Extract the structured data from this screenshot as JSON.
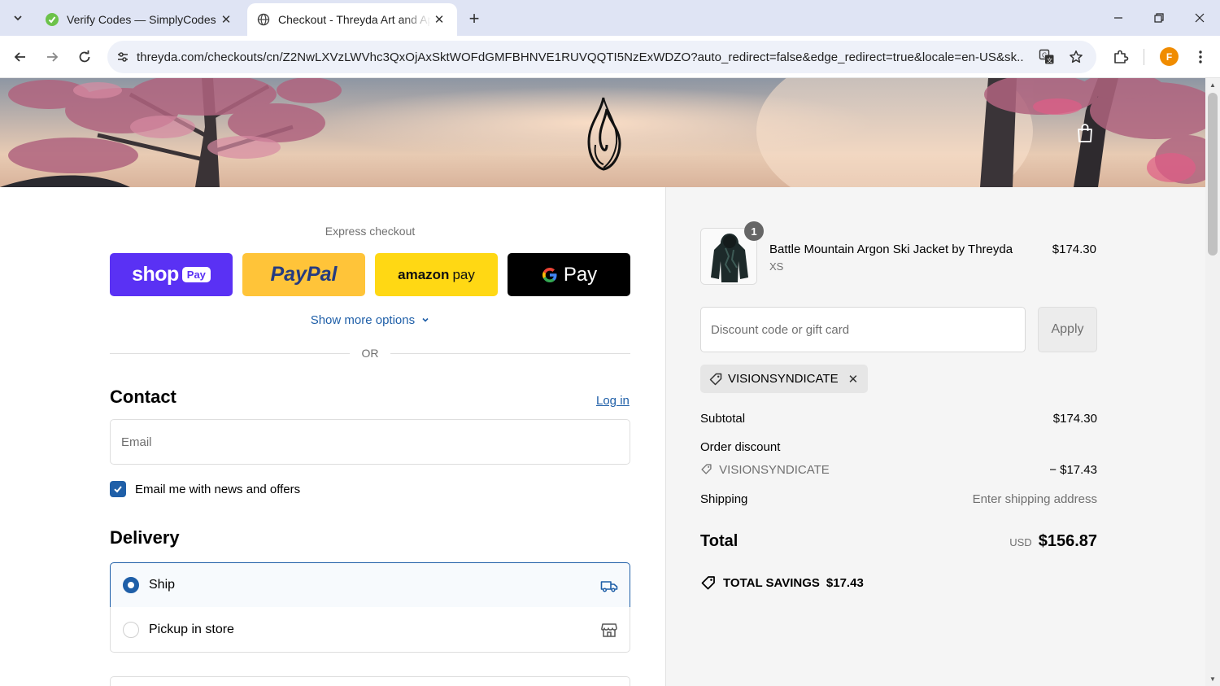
{
  "browser": {
    "tabs": [
      {
        "title": "Verify Codes — SimplyCodes",
        "active": false,
        "icon": "simplycodes-favicon"
      },
      {
        "title": "Checkout - Threyda Art and Apparel",
        "active": true,
        "icon": "globe-icon"
      }
    ],
    "url": "threyda.com/checkouts/cn/Z2NwLXVzLWVhc3QxOjAxSktWOFdGMFBHNVE1RUVQQTI5NzExWDZO?auto_redirect=false&edge_redirect=true&locale=en-US&sk...",
    "profile_initial": "F",
    "accent_color": "#f08c00"
  },
  "checkout": {
    "express_label": "Express checkout",
    "pay_buttons": [
      {
        "name": "Shop Pay",
        "brand": "shop",
        "badge": "Pay",
        "color": "#5a31f4"
      },
      {
        "name": "PayPal",
        "brand": "PayPal",
        "color": "#ffc439"
      },
      {
        "name": "Amazon Pay",
        "brand": "amazon",
        "suffix": "pay",
        "color": "#ffd814"
      },
      {
        "name": "Google Pay",
        "brand": "G",
        "suffix": "Pay",
        "color": "#000000"
      }
    ],
    "show_more": "Show more options",
    "or_label": "OR",
    "contact": {
      "heading": "Contact",
      "login_link": "Log in",
      "email_placeholder": "Email",
      "newsletter_label": "Email me with news and offers",
      "newsletter_checked": true
    },
    "delivery": {
      "heading": "Delivery",
      "options": [
        {
          "label": "Ship",
          "selected": true,
          "icon": "truck-icon"
        },
        {
          "label": "Pickup in store",
          "selected": false,
          "icon": "store-icon"
        }
      ]
    }
  },
  "summary": {
    "item": {
      "name": "Battle Mountain Argon Ski Jacket by Threyda",
      "variant": "XS",
      "price": "$174.30",
      "quantity": "1"
    },
    "discount_placeholder": "Discount code or gift card",
    "apply_label": "Apply",
    "applied_code": "VISIONSYNDICATE",
    "subtotal_label": "Subtotal",
    "subtotal": "$174.30",
    "order_discount_label": "Order discount",
    "discount_code": "VISIONSYNDICATE",
    "discount_amount": "− $17.43",
    "shipping_label": "Shipping",
    "shipping_value": "Enter shipping address",
    "total_label": "Total",
    "currency": "USD",
    "total": "$156.87",
    "savings_label": "TOTAL SAVINGS",
    "savings_amount": "$17.43"
  },
  "colors": {
    "link_blue": "#1f5fa8",
    "summary_bg": "#f5f5f5"
  }
}
